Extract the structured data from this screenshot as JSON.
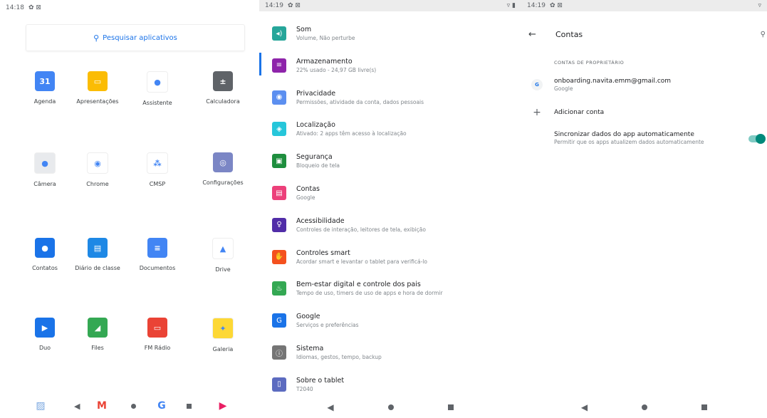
{
  "panel1": {
    "status_time": "14:18",
    "status_icons": "✿ ⊠",
    "search_placeholder": "Pesquisar aplicativos",
    "apps": [
      {
        "label": "Agenda",
        "icon": "calendar-icon",
        "glyph": "31",
        "color": "#4285f4"
      },
      {
        "label": "Apresentações",
        "icon": "slides-icon",
        "glyph": "▭",
        "color": "#fbbc04"
      },
      {
        "label": "Assistente",
        "icon": "assistant-icon",
        "glyph": "●",
        "color": "#ffffff"
      },
      {
        "label": "Calculadora",
        "icon": "calculator-icon",
        "glyph": "±",
        "color": "#5f6368"
      },
      {
        "label": "Câmera",
        "icon": "camera-icon",
        "glyph": "●",
        "color": "#e8eaed"
      },
      {
        "label": "Chrome",
        "icon": "chrome-icon",
        "glyph": "◉",
        "color": "#ffffff"
      },
      {
        "label": "CMSP",
        "icon": "cmsp-icon",
        "glyph": "⁂",
        "color": "#ffffff"
      },
      {
        "label": "Configurações",
        "icon": "settings-icon",
        "glyph": "◎",
        "color": "#7b86c5"
      },
      {
        "label": "Contatos",
        "icon": "contacts-icon",
        "glyph": "●",
        "color": "#1a73e8"
      },
      {
        "label": "Diário de classe",
        "icon": "class-diary-icon",
        "glyph": "▤",
        "color": "#1e88e5"
      },
      {
        "label": "Documentos",
        "icon": "docs-icon",
        "glyph": "≡",
        "color": "#4285f4"
      },
      {
        "label": "Drive",
        "icon": "drive-icon",
        "glyph": "▲",
        "color": "#ffffff"
      },
      {
        "label": "Duo",
        "icon": "duo-icon",
        "glyph": "▶",
        "color": "#1a73e8"
      },
      {
        "label": "Files",
        "icon": "files-icon",
        "glyph": "◢",
        "color": "#34a853"
      },
      {
        "label": "FM Rádio",
        "icon": "radio-icon",
        "glyph": "▭",
        "color": "#ea4335"
      },
      {
        "label": "Galeria",
        "icon": "gallery-icon",
        "glyph": "✦",
        "color": "#fdd835"
      }
    ],
    "dock": [
      {
        "icon": "photos-icon",
        "glyph": "▨",
        "color": "#7aa7e0"
      },
      {
        "icon": "gmail-icon",
        "glyph": "M",
        "color": "#ea4335"
      },
      {
        "icon": "google-icon",
        "glyph": "G",
        "color": "#4285f4"
      },
      {
        "icon": "play-store-icon",
        "glyph": "▶",
        "color": "#e91e63"
      }
    ]
  },
  "panel2": {
    "status_time": "14:19",
    "status_icons": "✿ ⊠",
    "items": [
      {
        "title": "Som",
        "subtitle": "Volume, Não perturbe",
        "icon": "sound-icon",
        "glyph": "◂)",
        "color": "#26a69a"
      },
      {
        "title": "Armazenamento",
        "subtitle": "22% usado - 24,97 GB livre(s)",
        "icon": "storage-icon",
        "glyph": "≡",
        "color": "#8e24aa"
      },
      {
        "title": "Privacidade",
        "subtitle": "Permissões, atividade da conta, dados pessoais",
        "icon": "privacy-icon",
        "glyph": "◉",
        "color": "#5c8ff0"
      },
      {
        "title": "Localização",
        "subtitle": "Ativado: 2 apps têm acesso à localização",
        "icon": "location-icon",
        "glyph": "◈",
        "color": "#26c6da"
      },
      {
        "title": "Segurança",
        "subtitle": "Bloqueio de tela",
        "icon": "security-icon",
        "glyph": "▣",
        "color": "#1e8e3e"
      },
      {
        "title": "Contas",
        "subtitle": "Google",
        "icon": "accounts-icon",
        "glyph": "▤",
        "color": "#ec407a"
      },
      {
        "title": "Acessibilidade",
        "subtitle": "Controles de interação, leitores de tela, exibição",
        "icon": "accessibility-icon",
        "glyph": "♀",
        "color": "#512da8"
      },
      {
        "title": "Controles smart",
        "subtitle": "Acordar smart e levantar o tablet para verificá-lo",
        "icon": "smart-controls-icon",
        "glyph": "✋",
        "color": "#f4511e"
      },
      {
        "title": "Bem-estar digital e controle dos pais",
        "subtitle": "Tempo de uso, timers de uso de apps e hora de dormir",
        "icon": "wellbeing-icon",
        "glyph": "♨",
        "color": "#34a853"
      },
      {
        "title": "Google",
        "subtitle": "Serviços e preferências",
        "icon": "google-icon",
        "glyph": "G",
        "color": "#1a73e8"
      },
      {
        "title": "Sistema",
        "subtitle": "Idiomas, gestos, tempo, backup",
        "icon": "system-icon",
        "glyph": "ⓘ",
        "color": "#757575"
      },
      {
        "title": "Sobre o tablet",
        "subtitle": "T2040",
        "icon": "about-tablet-icon",
        "glyph": "▯",
        "color": "#5c6bc0"
      }
    ]
  },
  "panel3": {
    "status_time": "14:19",
    "status_icons": "✿ ⊠",
    "title": "Contas",
    "section_label": "CONTAS DE PROPRIETÁRIO",
    "account_email": "onboarding.navita.emm@gmail.com",
    "account_type": "Google",
    "add_account": "Adicionar conta",
    "sync_title": "Sincronizar dados do app automaticamente",
    "sync_subtitle": "Permitir que os apps atualizem dados automaticamente",
    "sync_enabled": true
  }
}
